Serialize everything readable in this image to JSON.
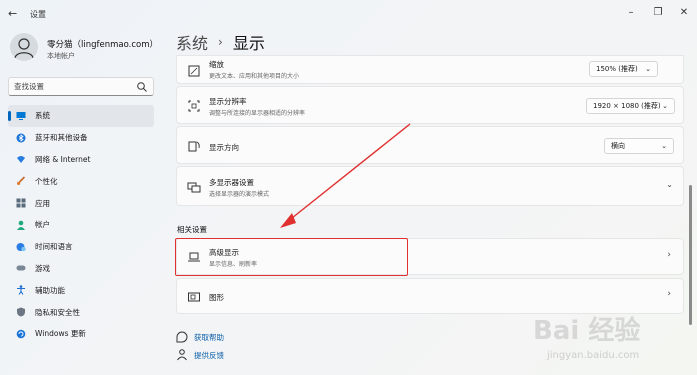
{
  "window": {
    "title": "设置",
    "back_icon": "arrow-left-icon",
    "controls": [
      "minimize-icon",
      "maximize-icon",
      "close-icon"
    ]
  },
  "profile": {
    "name": "零分猫（lingfenmao.com）",
    "account_type": "本地帐户"
  },
  "search": {
    "placeholder": "查找设置",
    "value": ""
  },
  "nav": [
    {
      "label": "系统",
      "icon": "monitor-icon",
      "active": true
    },
    {
      "label": "蓝牙和其他设备",
      "icon": "bluetooth-icon",
      "active": false
    },
    {
      "label": "网络 & Internet",
      "icon": "wifi-icon",
      "active": false
    },
    {
      "label": "个性化",
      "icon": "brush-icon",
      "active": false
    },
    {
      "label": "应用",
      "icon": "apps-icon",
      "active": false
    },
    {
      "label": "帐户",
      "icon": "person-icon",
      "active": false
    },
    {
      "label": "时间和语言",
      "icon": "globe-clock-icon",
      "active": false
    },
    {
      "label": "游戏",
      "icon": "gamepad-icon",
      "active": false
    },
    {
      "label": "辅助功能",
      "icon": "accessibility-icon",
      "active": false
    },
    {
      "label": "隐私和安全性",
      "icon": "shield-icon",
      "active": false
    },
    {
      "label": "Windows 更新",
      "icon": "sync-icon",
      "active": false
    }
  ],
  "breadcrumb": {
    "parent": "系统",
    "separator": "›",
    "current": "显示"
  },
  "scale": {
    "title": "缩放",
    "description": "更改文本、应用和其他项目的大小",
    "value": "150% (推荐)"
  },
  "resolution": {
    "title": "显示分辨率",
    "description": "调整与所连接的显示器相适的分辨率",
    "value": "1920 × 1080 (推荐)"
  },
  "orientation": {
    "title": "显示方向",
    "value": "横向"
  },
  "multi_display": {
    "title": "多显示器设置",
    "description": "选择显示器的演示模式"
  },
  "related": {
    "section_title": "相关设置",
    "advanced": {
      "title": "高级显示",
      "description": "显示信息、刷新率"
    },
    "graphics": {
      "title": "图形"
    }
  },
  "links": {
    "help": "获取帮助",
    "feedback": "提供反馈"
  },
  "annotation_color": "#e03030",
  "accent_color": "#0067c0",
  "watermark": {
    "main": "Bai 经验",
    "sub": "jingyan.baidu.com"
  }
}
